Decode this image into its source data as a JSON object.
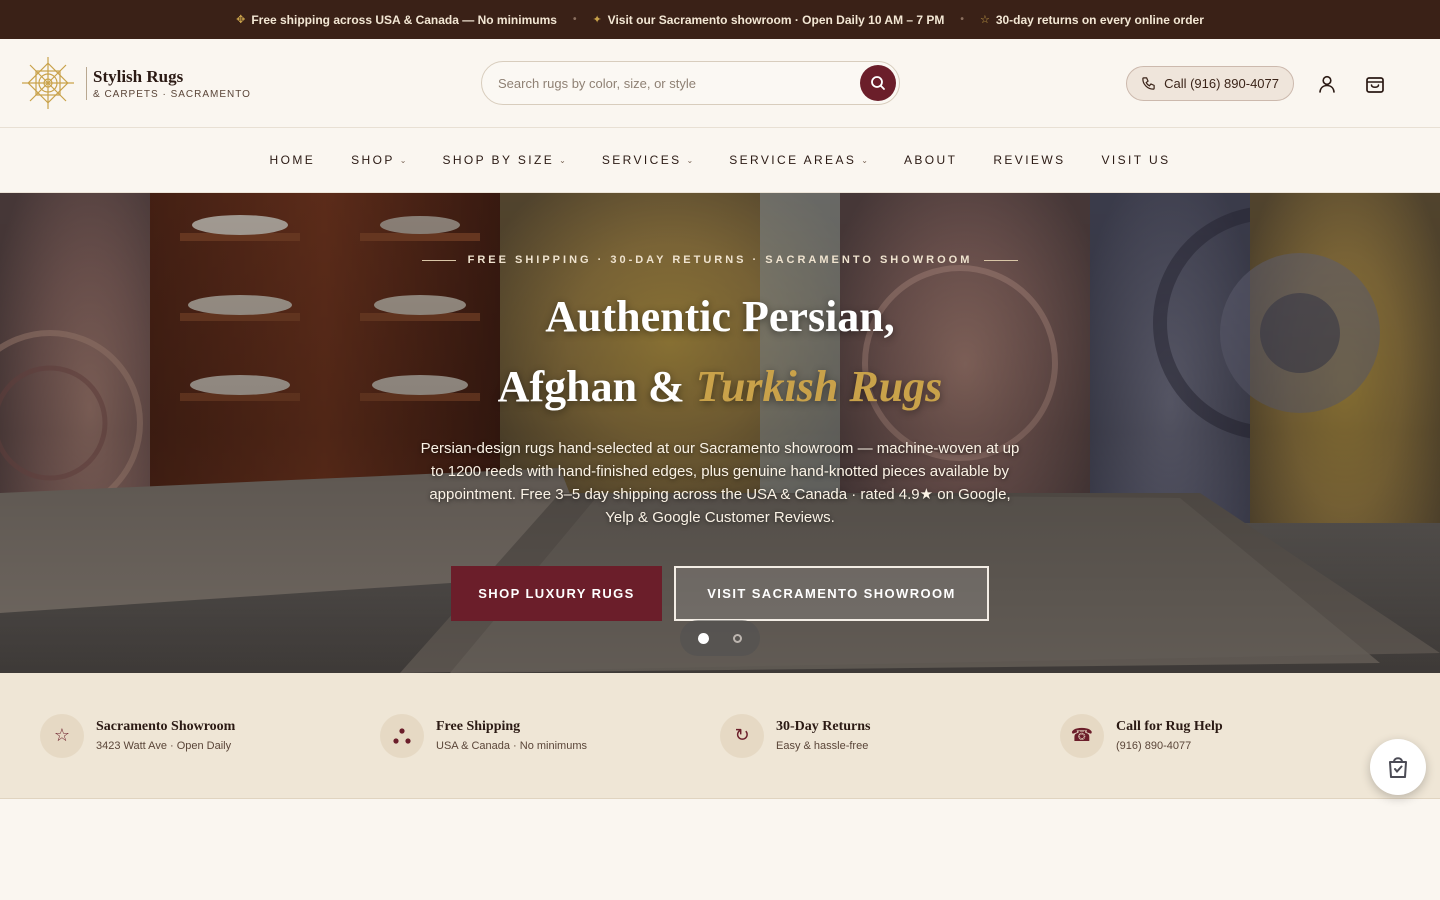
{
  "announcement": {
    "items": [
      {
        "icon": "diamond-icon",
        "text": "Free shipping across USA & Canada — No minimums"
      },
      {
        "icon": "star-icon",
        "text": "Visit our Sacramento showroom · Open Daily 10 AM – 7 PM"
      },
      {
        "icon": "star-outline-icon",
        "text": "30-day returns on every online order"
      }
    ]
  },
  "brand": {
    "name": "Stylish Rugs",
    "tagline": "& CARPETS · SACRAMENTO"
  },
  "search": {
    "placeholder": "Search rugs by color, size, or style"
  },
  "header": {
    "call_label": "Call (916) 890-4077"
  },
  "nav": {
    "items": [
      {
        "label": "HOME",
        "dropdown": false
      },
      {
        "label": "SHOP",
        "dropdown": true
      },
      {
        "label": "SHOP BY SIZE",
        "dropdown": true
      },
      {
        "label": "SERVICES",
        "dropdown": true
      },
      {
        "label": "SERVICE AREAS",
        "dropdown": true
      },
      {
        "label": "ABOUT",
        "dropdown": false
      },
      {
        "label": "REVIEWS",
        "dropdown": false
      },
      {
        "label": "VISIT US",
        "dropdown": false
      }
    ]
  },
  "hero": {
    "eyebrow": "FREE SHIPPING · 30-DAY RETURNS · SACRAMENTO SHOWROOM",
    "title_line1": "Authentic Persian,",
    "title_line2_plain": "Afghan & ",
    "title_line2_accent": "Turkish Rugs",
    "description": "Persian-design rugs hand-selected at our Sacramento showroom — machine-woven at up to 1200 reeds with hand-finished edges, plus genuine hand-knotted pieces available by appointment. Free 3–5 day shipping across the USA & Canada · rated 4.9★ on Google, Yelp & Google Customer Reviews.",
    "primary_cta": "SHOP LUXURY RUGS",
    "secondary_cta": "VISIT SACRAMENTO SHOWROOM",
    "slides_total": 2,
    "active_slide": 1
  },
  "features": [
    {
      "icon": "star-icon",
      "title": "Sacramento Showroom",
      "subtitle": "3423 Watt Ave · Open Daily"
    },
    {
      "icon": "truck-dots-icon",
      "title": "Free Shipping",
      "subtitle": "USA & Canada · No minimums"
    },
    {
      "icon": "refresh-icon",
      "title": "30-Day Returns",
      "subtitle": "Easy & hassle-free"
    },
    {
      "icon": "phone-icon",
      "title": "Call for Rug Help",
      "subtitle": "(916) 890-4077"
    }
  ],
  "colors": {
    "brand_burgundy": "#6b1e2a",
    "gold_accent": "#c9a24a",
    "announcement_bg": "#3a2117",
    "cream_bg": "#faf6f0",
    "features_bg": "#efe6d6"
  }
}
